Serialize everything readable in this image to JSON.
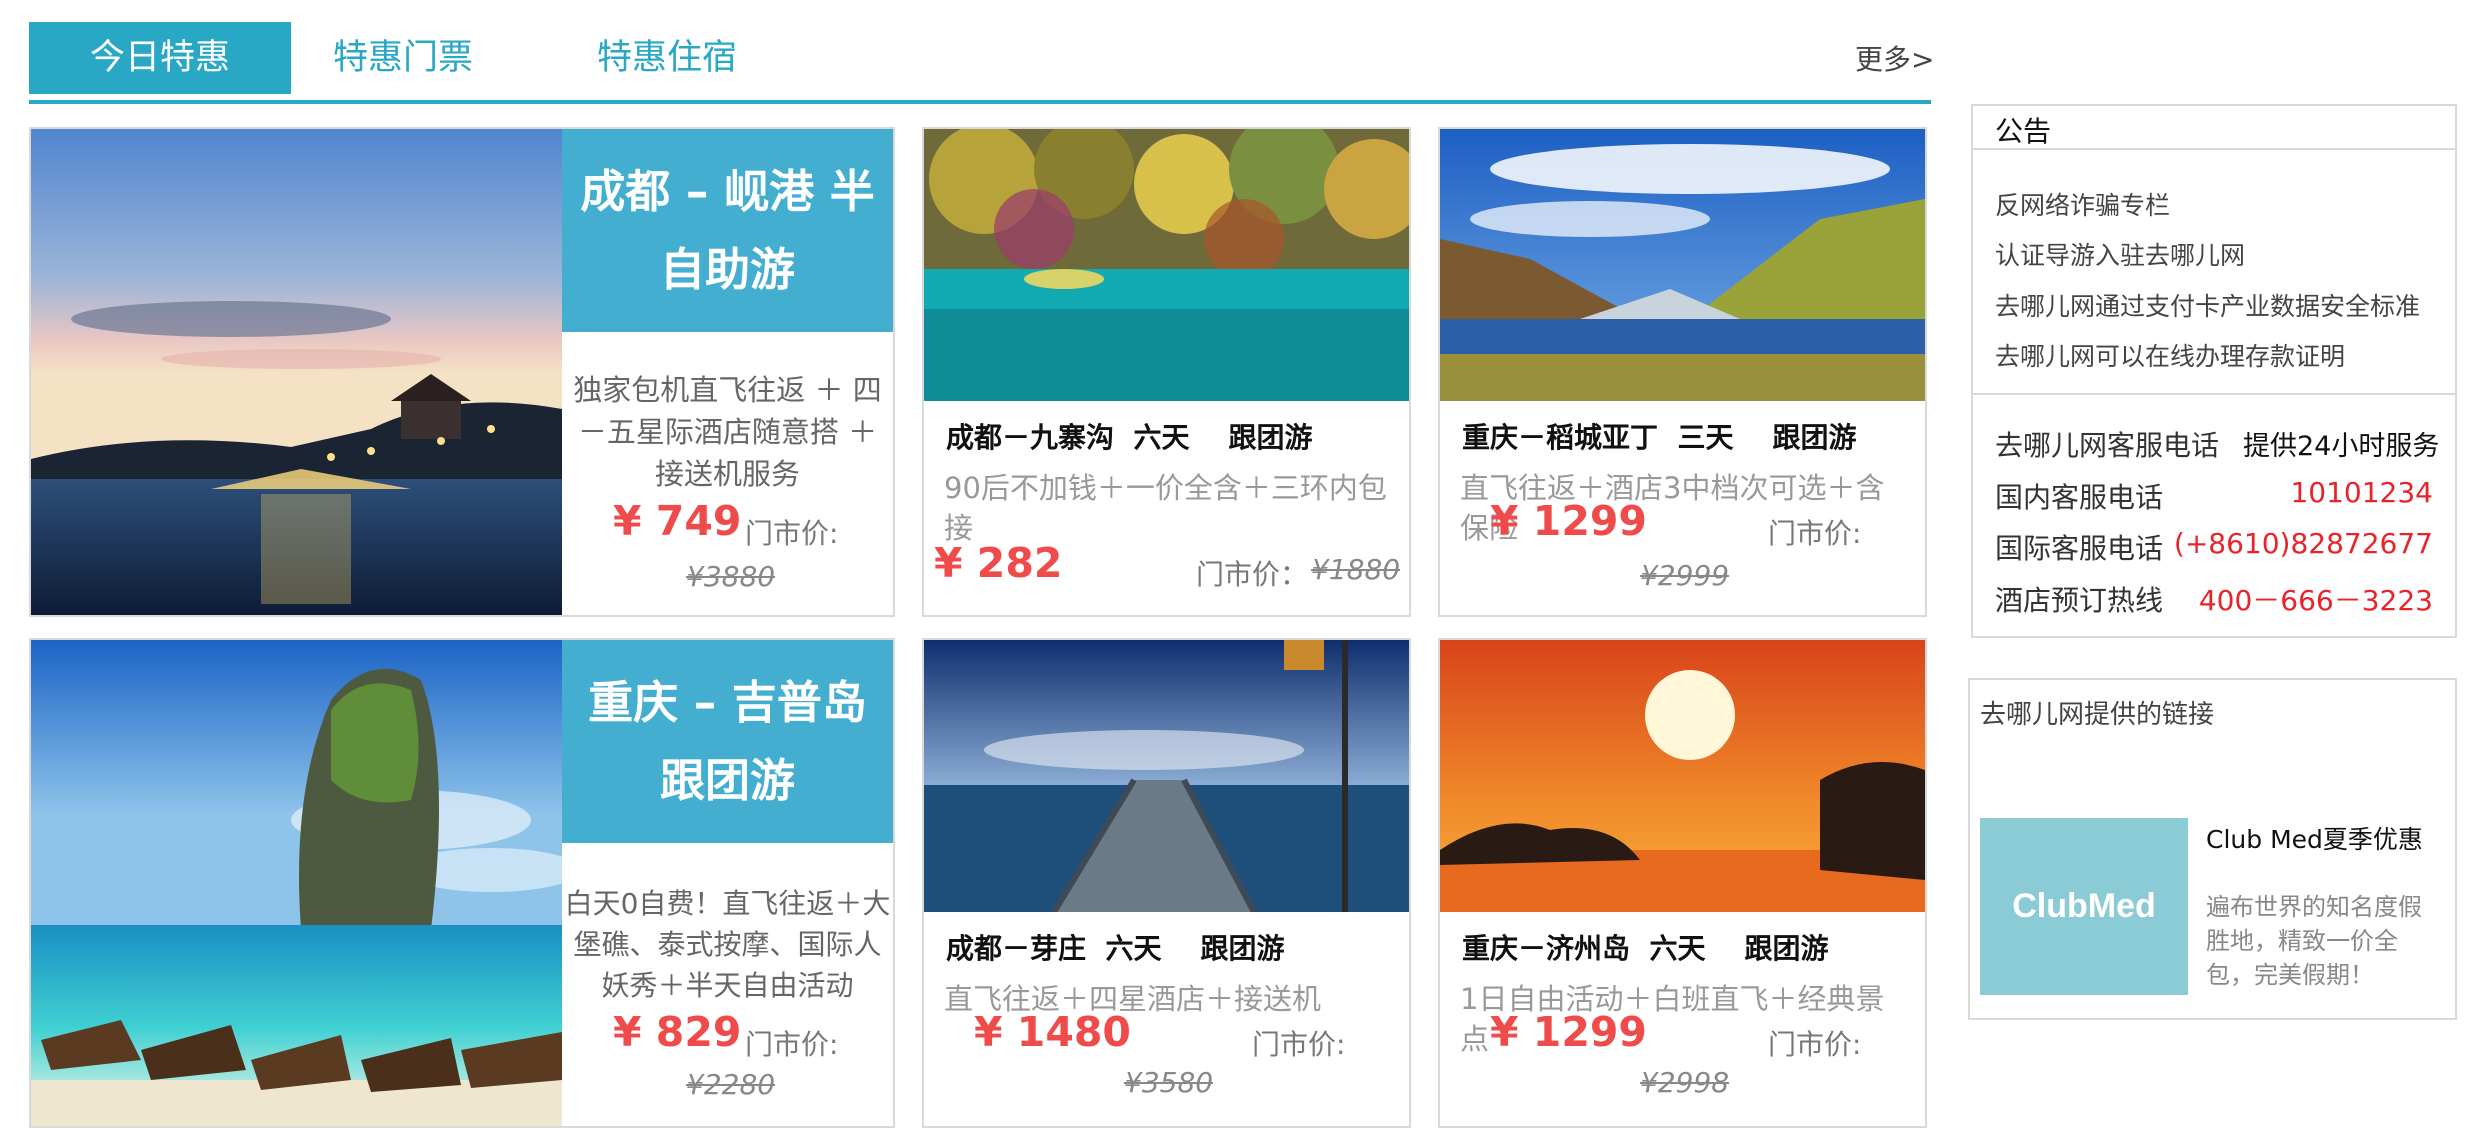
{
  "tabs": [
    {
      "label": "今日特惠",
      "active": true
    },
    {
      "label": "特惠门票",
      "active": false
    },
    {
      "label": "特惠住宿",
      "active": false
    }
  ],
  "more": "更多>",
  "colors": {
    "accent": "#29a8c5",
    "price": "#f04b4b",
    "hotline": "#e8232a",
    "title_block": "#43aed0"
  },
  "featured": [
    {
      "title": "成都 – 岘港 半自助游",
      "desc": "独家包机直飞往返 ＋ 四－五星际酒店随意搭 ＋ 接送机服务",
      "price": "¥ 749",
      "market_label": "门市价:",
      "original": "¥3880"
    },
    {
      "title": "重庆 – 吉普岛 跟团游",
      "desc": "白天0自费！直飞往返＋大堡礁、泰式按摩、国际人妖秀＋半天自由活动",
      "price": "¥ 829",
      "market_label": "门市价:",
      "original": "¥2280"
    }
  ],
  "cards": [
    {
      "title": "成都－九寨沟  六天    跟团游",
      "desc": "90后不加钱＋一价全含＋三环内包接",
      "price": "¥ 282",
      "market_label": "门市价：",
      "original": "¥1880"
    },
    {
      "title": "重庆－稻城亚丁  三天    跟团游",
      "desc": "直飞往返＋酒店3中档次可选＋含保险",
      "price": "¥ 1299",
      "market_label": "门市价:",
      "original": "¥2999"
    },
    {
      "title": "成都－芽庄  六天    跟团游",
      "desc": "直飞往返＋四星酒店＋接送机",
      "price": "¥ 1480",
      "market_label": "门市价:",
      "original": "¥3580"
    },
    {
      "title": "重庆－济州岛  六天    跟团游",
      "desc": "1日自由活动＋白班直飞＋经典景点",
      "price": "¥ 1299",
      "market_label": "门市价:",
      "original": "¥2998"
    }
  ],
  "notice": {
    "title": "公告",
    "links": [
      "反网络诈骗专栏",
      "认证导游入驻去哪儿网",
      "去哪儿网通过支付卡产业数据安全标准",
      "去哪儿网可以在线办理存款证明"
    ],
    "hotlines": [
      {
        "label": "去哪儿网客服电话",
        "value": "提供24小时服务"
      },
      {
        "label": "国内客服电话",
        "value": "10101234"
      },
      {
        "label": "国际客服电话",
        "value": "(+8610)82872677"
      },
      {
        "label": "酒店预订热线",
        "value": "400－666－3223"
      }
    ]
  },
  "promo": {
    "header": "去哪儿网提供的链接",
    "logo_text": "ClubMed",
    "title": "Club Med夏季优惠",
    "desc": "遍布世界的知名度假胜地，精致一价全包，完美假期！"
  }
}
